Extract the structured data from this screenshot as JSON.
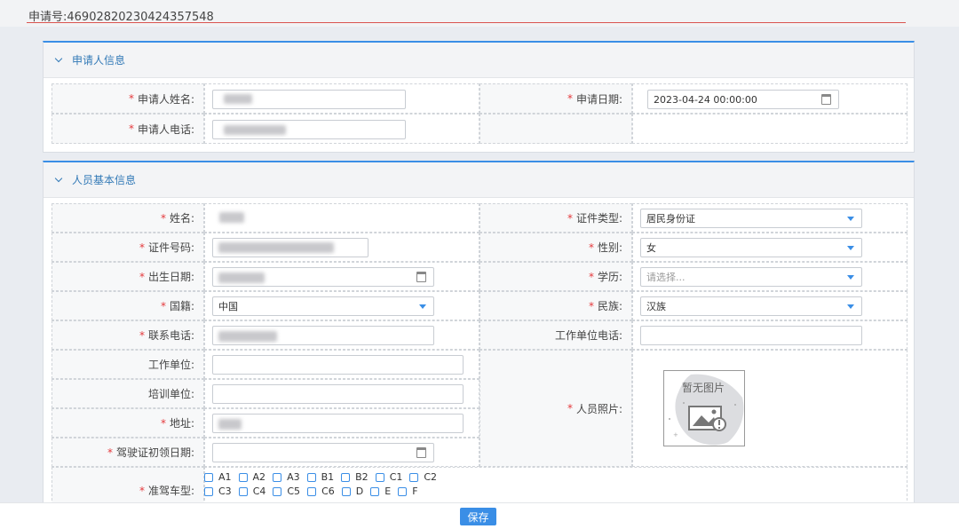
{
  "application": {
    "label": "申请号:",
    "number": "46902820230424357548"
  },
  "applicant_section": {
    "title": "申请人信息",
    "name_label": "申请人姓名:",
    "date_label": "申请日期:",
    "date_value": "2023-04-24 00:00:00",
    "phone_label": "申请人电话:"
  },
  "person_section": {
    "title": "人员基本信息",
    "name_label": "姓名:",
    "id_type_label": "证件类型:",
    "id_type_value": "居民身份证",
    "id_no_label": "证件号码:",
    "gender_label": "性别:",
    "gender_value": "女",
    "birth_label": "出生日期:",
    "education_label": "学历:",
    "education_placeholder": "请选择...",
    "nationality_label": "国籍:",
    "nationality_value": "中国",
    "ethnicity_label": "民族:",
    "ethnicity_value": "汉族",
    "contact_label": "联系电话:",
    "work_phone_label": "工作单位电话:",
    "work_unit_label": "工作单位:",
    "training_unit_label": "培训单位:",
    "address_label": "地址:",
    "photo_label": "人员照片:",
    "photo_placeholder": "暂无图片",
    "license_date_label": "驾驶证初领日期:",
    "vehicle_type_label": "准驾车型:",
    "vehicle_types_row1": [
      "A1",
      "A2",
      "A3",
      "B1",
      "B2",
      "C1",
      "C2"
    ],
    "vehicle_types_row2": [
      "C3",
      "C4",
      "C5",
      "C6",
      "D",
      "E",
      "F"
    ]
  },
  "footer": {
    "save_label": "保存"
  },
  "colors": {
    "accent": "#3a8ee6",
    "required": "#e4393c",
    "title_underline": "#d9534f"
  }
}
